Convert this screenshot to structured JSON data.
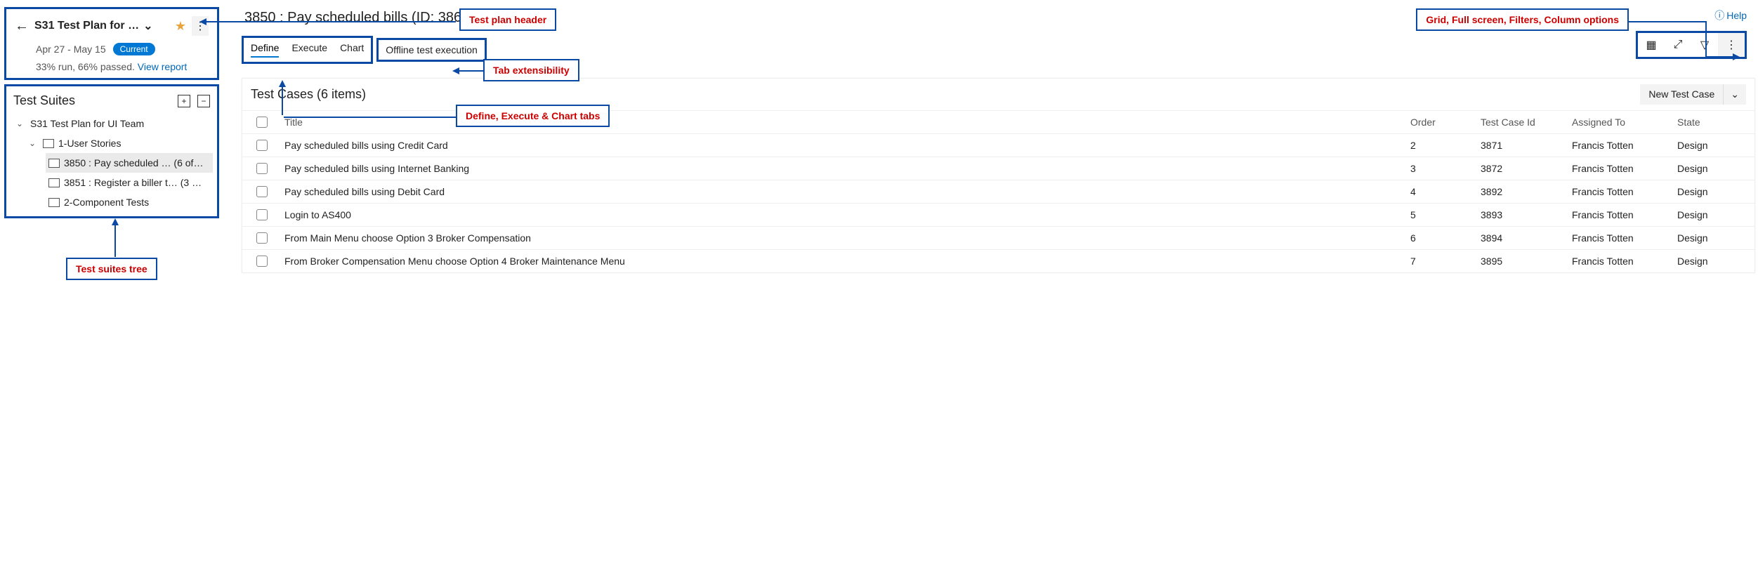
{
  "callouts": {
    "plan_header": "Test plan header",
    "tab_ext": "Tab extensibility",
    "tabs_desc": "Define, Execute & Chart tabs",
    "toolbar": "Grid, Full screen, Filters, Column options",
    "suites_tree": "Test suites tree"
  },
  "help_label": "Help",
  "plan_header": {
    "title": "S31 Test Plan for …",
    "date_range": "Apr 27 - May 15",
    "current_label": "Current",
    "stats_text": "33% run, 66% passed.",
    "view_report": "View report"
  },
  "suites_panel": {
    "title": "Test Suites",
    "tree": {
      "root": "S31 Test Plan for UI Team",
      "n1": "1-User Stories",
      "n1a": "3850 : Pay scheduled … (6 of…",
      "n1b": "3851 : Register a biller t… (3 …",
      "n2": "2-Component Tests"
    }
  },
  "suite_title": "3850 : Pay scheduled bills (ID: 3866)",
  "tabs": {
    "define": "Define",
    "execute": "Execute",
    "chart": "Chart",
    "offline": "Offline test execution"
  },
  "test_cases": {
    "header": "Test Cases (6 items)",
    "new_btn": "New Test Case",
    "columns": {
      "title": "Title",
      "order": "Order",
      "id": "Test Case Id",
      "assigned": "Assigned To",
      "state": "State"
    },
    "rows": [
      {
        "title": "Pay scheduled bills using Credit Card",
        "order": "2",
        "id": "3871",
        "assigned": "Francis Totten",
        "state": "Design"
      },
      {
        "title": "Pay scheduled bills using Internet Banking",
        "order": "3",
        "id": "3872",
        "assigned": "Francis Totten",
        "state": "Design"
      },
      {
        "title": "Pay scheduled bills using Debit Card",
        "order": "4",
        "id": "3892",
        "assigned": "Francis Totten",
        "state": "Design"
      },
      {
        "title": "Login to AS400",
        "order": "5",
        "id": "3893",
        "assigned": "Francis Totten",
        "state": "Design"
      },
      {
        "title": "From Main Menu choose Option 3 Broker Compensation",
        "order": "6",
        "id": "3894",
        "assigned": "Francis Totten",
        "state": "Design"
      },
      {
        "title": "From Broker Compensation Menu choose Option 4 Broker Maintenance Menu",
        "order": "7",
        "id": "3895",
        "assigned": "Francis Totten",
        "state": "Design"
      }
    ]
  }
}
